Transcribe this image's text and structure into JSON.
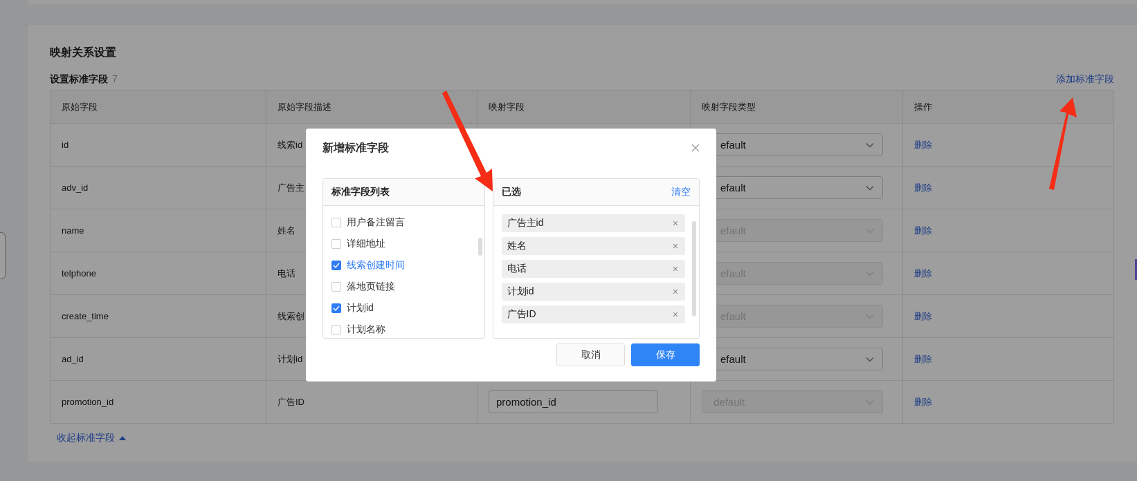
{
  "section": {
    "title": "映射关系设置",
    "subtitle": "设置标准字段",
    "count": "7",
    "add_link": "添加标准字段",
    "collapse_link": "收起标准字段"
  },
  "table": {
    "columns": [
      "原始字段",
      "原始字段描述",
      "映射字段",
      "映射字段类型",
      "操作"
    ],
    "rows": [
      {
        "field": "id",
        "description": "线索id",
        "type": "efault",
        "disabled": false,
        "action": "删除"
      },
      {
        "field": "adv_id",
        "description": "广告主",
        "type": "efault",
        "disabled": false,
        "action": "删除"
      },
      {
        "field": "name",
        "description": "姓名",
        "type": "efault",
        "disabled": true,
        "action": "删除"
      },
      {
        "field": "telphone",
        "description": "电话",
        "type": "efault",
        "disabled": true,
        "action": "删除"
      },
      {
        "field": "create_time",
        "description": "线索创",
        "type": "efault",
        "disabled": true,
        "action": "删除"
      },
      {
        "field": "ad_id",
        "description": "计划id",
        "type": "efault",
        "disabled": false,
        "action": "删除"
      },
      {
        "field": "promotion_id",
        "description": "广告ID",
        "mapping": "promotion_id",
        "type": "default",
        "disabled": true,
        "action": "删除"
      }
    ]
  },
  "dialog": {
    "title": "新增标准字段",
    "left_panel": {
      "title": "标准字段列表",
      "items": [
        {
          "label": "用户备注留言",
          "checked": false,
          "highlighted": false
        },
        {
          "label": "详细地址",
          "checked": false,
          "highlighted": false
        },
        {
          "label": "线索创建时间",
          "checked": true,
          "highlighted": true
        },
        {
          "label": "落地页链接",
          "checked": false,
          "highlighted": false
        },
        {
          "label": "计划id",
          "checked": true,
          "highlighted": false
        },
        {
          "label": "计划名称",
          "checked": false,
          "highlighted": false
        }
      ]
    },
    "right_panel": {
      "title": "已选",
      "clear": "清空",
      "items": [
        "广告主id",
        "姓名",
        "电话",
        "计划id",
        "广告ID"
      ]
    },
    "buttons": [
      {
        "label": "取消",
        "kind": "secondary"
      },
      {
        "label": "保存",
        "kind": "primary"
      }
    ]
  }
}
